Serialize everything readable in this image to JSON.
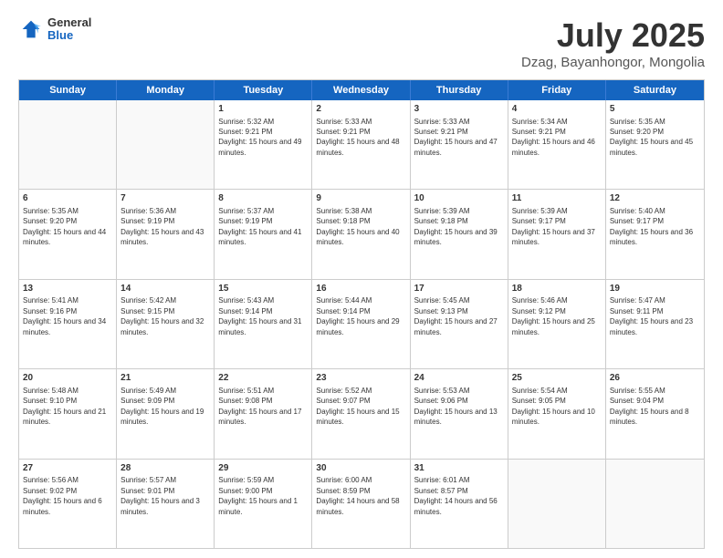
{
  "header": {
    "logo": {
      "general": "General",
      "blue": "Blue"
    },
    "title": "July 2025",
    "subtitle": "Dzag, Bayanhongor, Mongolia"
  },
  "calendar": {
    "days": [
      "Sunday",
      "Monday",
      "Tuesday",
      "Wednesday",
      "Thursday",
      "Friday",
      "Saturday"
    ],
    "weeks": [
      [
        {
          "day": "",
          "sunrise": "",
          "sunset": "",
          "daylight": ""
        },
        {
          "day": "",
          "sunrise": "",
          "sunset": "",
          "daylight": ""
        },
        {
          "day": "1",
          "sunrise": "Sunrise: 5:32 AM",
          "sunset": "Sunset: 9:21 PM",
          "daylight": "Daylight: 15 hours and 49 minutes."
        },
        {
          "day": "2",
          "sunrise": "Sunrise: 5:33 AM",
          "sunset": "Sunset: 9:21 PM",
          "daylight": "Daylight: 15 hours and 48 minutes."
        },
        {
          "day": "3",
          "sunrise": "Sunrise: 5:33 AM",
          "sunset": "Sunset: 9:21 PM",
          "daylight": "Daylight: 15 hours and 47 minutes."
        },
        {
          "day": "4",
          "sunrise": "Sunrise: 5:34 AM",
          "sunset": "Sunset: 9:21 PM",
          "daylight": "Daylight: 15 hours and 46 minutes."
        },
        {
          "day": "5",
          "sunrise": "Sunrise: 5:35 AM",
          "sunset": "Sunset: 9:20 PM",
          "daylight": "Daylight: 15 hours and 45 minutes."
        }
      ],
      [
        {
          "day": "6",
          "sunrise": "Sunrise: 5:35 AM",
          "sunset": "Sunset: 9:20 PM",
          "daylight": "Daylight: 15 hours and 44 minutes."
        },
        {
          "day": "7",
          "sunrise": "Sunrise: 5:36 AM",
          "sunset": "Sunset: 9:19 PM",
          "daylight": "Daylight: 15 hours and 43 minutes."
        },
        {
          "day": "8",
          "sunrise": "Sunrise: 5:37 AM",
          "sunset": "Sunset: 9:19 PM",
          "daylight": "Daylight: 15 hours and 41 minutes."
        },
        {
          "day": "9",
          "sunrise": "Sunrise: 5:38 AM",
          "sunset": "Sunset: 9:18 PM",
          "daylight": "Daylight: 15 hours and 40 minutes."
        },
        {
          "day": "10",
          "sunrise": "Sunrise: 5:39 AM",
          "sunset": "Sunset: 9:18 PM",
          "daylight": "Daylight: 15 hours and 39 minutes."
        },
        {
          "day": "11",
          "sunrise": "Sunrise: 5:39 AM",
          "sunset": "Sunset: 9:17 PM",
          "daylight": "Daylight: 15 hours and 37 minutes."
        },
        {
          "day": "12",
          "sunrise": "Sunrise: 5:40 AM",
          "sunset": "Sunset: 9:17 PM",
          "daylight": "Daylight: 15 hours and 36 minutes."
        }
      ],
      [
        {
          "day": "13",
          "sunrise": "Sunrise: 5:41 AM",
          "sunset": "Sunset: 9:16 PM",
          "daylight": "Daylight: 15 hours and 34 minutes."
        },
        {
          "day": "14",
          "sunrise": "Sunrise: 5:42 AM",
          "sunset": "Sunset: 9:15 PM",
          "daylight": "Daylight: 15 hours and 32 minutes."
        },
        {
          "day": "15",
          "sunrise": "Sunrise: 5:43 AM",
          "sunset": "Sunset: 9:14 PM",
          "daylight": "Daylight: 15 hours and 31 minutes."
        },
        {
          "day": "16",
          "sunrise": "Sunrise: 5:44 AM",
          "sunset": "Sunset: 9:14 PM",
          "daylight": "Daylight: 15 hours and 29 minutes."
        },
        {
          "day": "17",
          "sunrise": "Sunrise: 5:45 AM",
          "sunset": "Sunset: 9:13 PM",
          "daylight": "Daylight: 15 hours and 27 minutes."
        },
        {
          "day": "18",
          "sunrise": "Sunrise: 5:46 AM",
          "sunset": "Sunset: 9:12 PM",
          "daylight": "Daylight: 15 hours and 25 minutes."
        },
        {
          "day": "19",
          "sunrise": "Sunrise: 5:47 AM",
          "sunset": "Sunset: 9:11 PM",
          "daylight": "Daylight: 15 hours and 23 minutes."
        }
      ],
      [
        {
          "day": "20",
          "sunrise": "Sunrise: 5:48 AM",
          "sunset": "Sunset: 9:10 PM",
          "daylight": "Daylight: 15 hours and 21 minutes."
        },
        {
          "day": "21",
          "sunrise": "Sunrise: 5:49 AM",
          "sunset": "Sunset: 9:09 PM",
          "daylight": "Daylight: 15 hours and 19 minutes."
        },
        {
          "day": "22",
          "sunrise": "Sunrise: 5:51 AM",
          "sunset": "Sunset: 9:08 PM",
          "daylight": "Daylight: 15 hours and 17 minutes."
        },
        {
          "day": "23",
          "sunrise": "Sunrise: 5:52 AM",
          "sunset": "Sunset: 9:07 PM",
          "daylight": "Daylight: 15 hours and 15 minutes."
        },
        {
          "day": "24",
          "sunrise": "Sunrise: 5:53 AM",
          "sunset": "Sunset: 9:06 PM",
          "daylight": "Daylight: 15 hours and 13 minutes."
        },
        {
          "day": "25",
          "sunrise": "Sunrise: 5:54 AM",
          "sunset": "Sunset: 9:05 PM",
          "daylight": "Daylight: 15 hours and 10 minutes."
        },
        {
          "day": "26",
          "sunrise": "Sunrise: 5:55 AM",
          "sunset": "Sunset: 9:04 PM",
          "daylight": "Daylight: 15 hours and 8 minutes."
        }
      ],
      [
        {
          "day": "27",
          "sunrise": "Sunrise: 5:56 AM",
          "sunset": "Sunset: 9:02 PM",
          "daylight": "Daylight: 15 hours and 6 minutes."
        },
        {
          "day": "28",
          "sunrise": "Sunrise: 5:57 AM",
          "sunset": "Sunset: 9:01 PM",
          "daylight": "Daylight: 15 hours and 3 minutes."
        },
        {
          "day": "29",
          "sunrise": "Sunrise: 5:59 AM",
          "sunset": "Sunset: 9:00 PM",
          "daylight": "Daylight: 15 hours and 1 minute."
        },
        {
          "day": "30",
          "sunrise": "Sunrise: 6:00 AM",
          "sunset": "Sunset: 8:59 PM",
          "daylight": "Daylight: 14 hours and 58 minutes."
        },
        {
          "day": "31",
          "sunrise": "Sunrise: 6:01 AM",
          "sunset": "Sunset: 8:57 PM",
          "daylight": "Daylight: 14 hours and 56 minutes."
        },
        {
          "day": "",
          "sunrise": "",
          "sunset": "",
          "daylight": ""
        },
        {
          "day": "",
          "sunrise": "",
          "sunset": "",
          "daylight": ""
        }
      ]
    ]
  }
}
